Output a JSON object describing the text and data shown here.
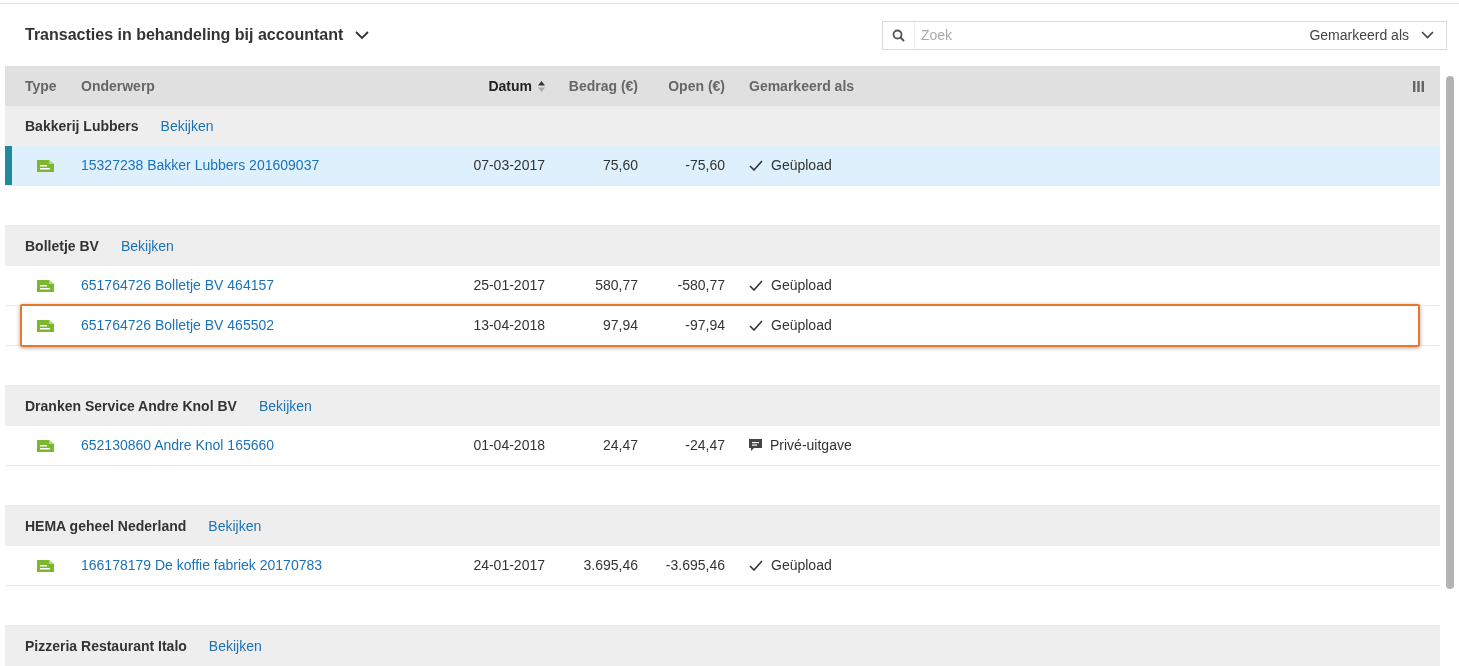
{
  "title": "Transacties in behandeling bij accountant",
  "search": {
    "placeholder": "Zoek",
    "filter_label": "Gemarkeerd als"
  },
  "columns": [
    {
      "label": "Type",
      "sorted": false
    },
    {
      "label": "Onderwerp",
      "sorted": false
    },
    {
      "label": "Datum",
      "sorted": true
    },
    {
      "label": "Bedrag (€)",
      "sorted": false
    },
    {
      "label": "Open (€)",
      "sorted": false
    },
    {
      "label": "Gemarkeerd als",
      "sorted": false
    }
  ],
  "groups": [
    {
      "name": "Bakkerij Lubbers",
      "link": "Bekijken",
      "rows": [
        {
          "subject": "15327238 Bakker Lubbers 201609037",
          "date": "07-03-2017",
          "amount": "75,60",
          "open": "-75,60",
          "mark": {
            "kind": "uploaded",
            "label": "Geüpload"
          },
          "selected": true,
          "highlighted": false
        }
      ]
    },
    {
      "name": "Bolletje BV",
      "link": "Bekijken",
      "rows": [
        {
          "subject": "651764726 Bolletje BV 464157",
          "date": "25-01-2017",
          "amount": "580,77",
          "open": "-580,77",
          "mark": {
            "kind": "uploaded",
            "label": "Geüpload"
          },
          "selected": false,
          "highlighted": false
        },
        {
          "subject": "651764726 Bolletje BV 465502",
          "date": "13-04-2018",
          "amount": "97,94",
          "open": "-97,94",
          "mark": {
            "kind": "uploaded",
            "label": "Geüpload"
          },
          "selected": false,
          "highlighted": true
        }
      ]
    },
    {
      "name": "Dranken Service Andre Knol BV",
      "link": "Bekijken",
      "rows": [
        {
          "subject": "652130860 Andre Knol 165660",
          "date": "01-04-2018",
          "amount": "24,47",
          "open": "-24,47",
          "mark": {
            "kind": "private",
            "label": "Privé-uitgave"
          },
          "selected": false,
          "highlighted": false
        }
      ]
    },
    {
      "name": "HEMA geheel Nederland",
      "link": "Bekijken",
      "rows": [
        {
          "subject": "166178179 De koffie fabriek 20170783",
          "date": "24-01-2017",
          "amount": "3.695,46",
          "open": "-3.695,46",
          "mark": {
            "kind": "uploaded",
            "label": "Geüpload"
          },
          "selected": false,
          "highlighted": false
        }
      ]
    },
    {
      "name": "Pizzeria Restaurant Italo",
      "link": "Bekijken"
    }
  ]
}
